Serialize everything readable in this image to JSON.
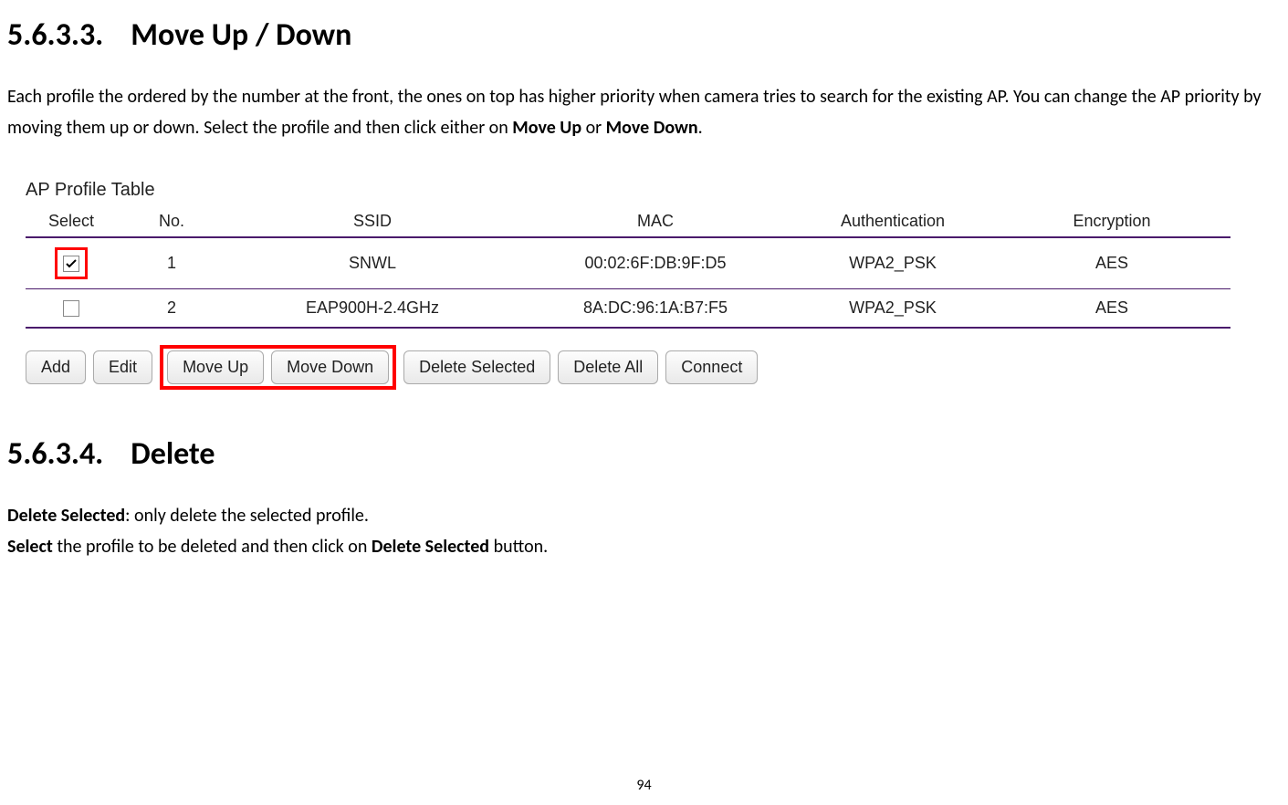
{
  "section1": {
    "number": "5.6.3.3.",
    "title": "Move Up / Down",
    "para_pre": "Each profile the ordered by the number at the front, the ones on top has higher priority when camera tries to search for the existing AP. You can change the AP priority by moving them up or down. Select the profile and then click either on ",
    "bold1": "Move Up",
    "mid": " or ",
    "bold2": "Move Down",
    "post": "."
  },
  "screenshot": {
    "table_title": "AP Profile Table",
    "headers": {
      "select": "Select",
      "no": "No.",
      "ssid": "SSID",
      "mac": "MAC",
      "auth": "Authentication",
      "enc": "Encryption"
    },
    "rows": [
      {
        "selected": true,
        "no": "1",
        "ssid": "SNWL",
        "mac": "00:02:6F:DB:9F:D5",
        "auth": "WPA2_PSK",
        "enc": "AES"
      },
      {
        "selected": false,
        "no": "2",
        "ssid": "EAP900H-2.4GHz",
        "mac": "8A:DC:96:1A:B7:F5",
        "auth": "WPA2_PSK",
        "enc": "AES"
      }
    ],
    "buttons": {
      "add": "Add",
      "edit": "Edit",
      "move_up": "Move Up",
      "move_down": "Move Down",
      "delete_selected": "Delete Selected",
      "delete_all": "Delete All",
      "connect": "Connect"
    }
  },
  "section2": {
    "number": "5.6.3.4.",
    "title": "Delete",
    "line1_bold": "Delete Selected",
    "line1_rest": ": only delete the selected profile.",
    "line2_bold1": "Select",
    "line2_mid": " the profile to be deleted and then click on ",
    "line2_bold2": "Delete Selected",
    "line2_post": " button."
  },
  "page_number": "94"
}
